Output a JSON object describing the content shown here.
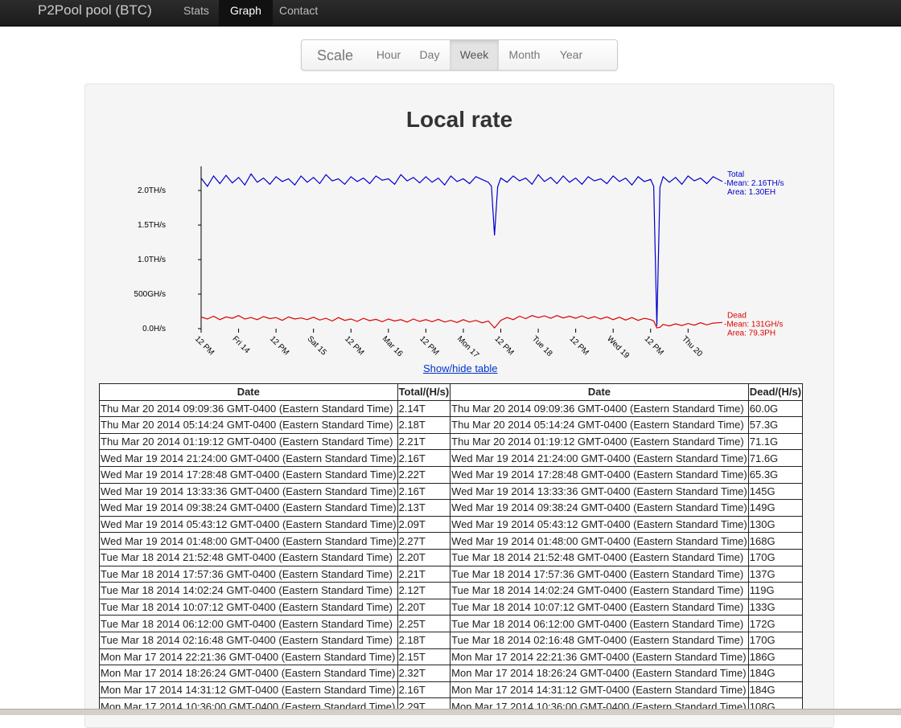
{
  "navbar": {
    "brand": "P2Pool pool (BTC)",
    "items": [
      {
        "label": "Stats",
        "active": false
      },
      {
        "label": "Graph",
        "active": true
      },
      {
        "label": "Contact",
        "active": false
      }
    ]
  },
  "scale": {
    "label": "Scale",
    "options": [
      {
        "label": "Hour",
        "active": false
      },
      {
        "label": "Day",
        "active": false
      },
      {
        "label": "Week",
        "active": true
      },
      {
        "label": "Month",
        "active": false
      },
      {
        "label": "Year",
        "active": false
      }
    ]
  },
  "graph": {
    "title": "Local rate",
    "toggle_label": "Show/hide table"
  },
  "chart_data": {
    "type": "line",
    "title": "Local rate",
    "y_ticks": [
      "0.0H/s",
      "500GH/s",
      "1.0TH/s",
      "1.5TH/s",
      "2.0TH/s"
    ],
    "y_tick_values": [
      0,
      500,
      1000,
      1500,
      2000
    ],
    "ylim": [
      0,
      2350
    ],
    "x_ticks": [
      "12 PM",
      "Fri 14",
      "12 PM",
      "Sat 15",
      "12 PM",
      "Mar 16",
      "12 PM",
      "Mon 17",
      "12 PM",
      "Tue 18",
      "12 PM",
      "Wed 19",
      "12 PM",
      "Thu 20"
    ],
    "x_tick_hours": [
      0,
      12,
      24,
      36,
      48,
      60,
      72,
      84,
      96,
      108,
      120,
      132,
      144,
      156
    ],
    "x_range_hours": [
      0,
      167
    ],
    "series": [
      {
        "name": "Total",
        "color": "#0000cc",
        "labels": [
          "Total",
          "-Mean: 2.16TH/s",
          "Area: 1.30EH"
        ],
        "points": [
          [
            0,
            2180
          ],
          [
            2,
            2060
          ],
          [
            4,
            2210
          ],
          [
            6,
            2100
          ],
          [
            8,
            2220
          ],
          [
            10,
            2110
          ],
          [
            12,
            2190
          ],
          [
            14,
            2080
          ],
          [
            16,
            2240
          ],
          [
            18,
            2120
          ],
          [
            20,
            2180
          ],
          [
            22,
            2090
          ],
          [
            24,
            2200
          ],
          [
            26,
            2130
          ],
          [
            28,
            2170
          ],
          [
            30,
            2080
          ],
          [
            32,
            2210
          ],
          [
            34,
            2120
          ],
          [
            36,
            2190
          ],
          [
            38,
            2100
          ],
          [
            40,
            2230
          ],
          [
            42,
            2140
          ],
          [
            44,
            2170
          ],
          [
            46,
            2090
          ],
          [
            48,
            2200
          ],
          [
            50,
            2130
          ],
          [
            52,
            2180
          ],
          [
            54,
            2100
          ],
          [
            56,
            2210
          ],
          [
            58,
            2150
          ],
          [
            60,
            2170
          ],
          [
            62,
            2090
          ],
          [
            64,
            2230
          ],
          [
            66,
            2140
          ],
          [
            68,
            2190
          ],
          [
            70,
            2110
          ],
          [
            72,
            2200
          ],
          [
            74,
            2120
          ],
          [
            76,
            2180
          ],
          [
            78,
            2080
          ],
          [
            80,
            2210
          ],
          [
            82,
            2130
          ],
          [
            84,
            2170
          ],
          [
            86,
            2100
          ],
          [
            88,
            2200
          ],
          [
            90,
            2160
          ],
          [
            92,
            2120
          ],
          [
            93,
            2060
          ],
          [
            94,
            1350
          ],
          [
            95,
            2050
          ],
          [
            96,
            2180
          ],
          [
            98,
            2120
          ],
          [
            100,
            2210
          ],
          [
            102,
            2140
          ],
          [
            104,
            2180
          ],
          [
            106,
            2090
          ],
          [
            108,
            2230
          ],
          [
            110,
            2130
          ],
          [
            112,
            2190
          ],
          [
            114,
            2100
          ],
          [
            116,
            2210
          ],
          [
            118,
            2120
          ],
          [
            120,
            2180
          ],
          [
            122,
            2090
          ],
          [
            124,
            2200
          ],
          [
            126,
            2140
          ],
          [
            128,
            2170
          ],
          [
            130,
            2100
          ],
          [
            132,
            2210
          ],
          [
            134,
            2130
          ],
          [
            136,
            2180
          ],
          [
            138,
            2080
          ],
          [
            140,
            2200
          ],
          [
            142,
            2130
          ],
          [
            144,
            2160
          ],
          [
            145,
            2060
          ],
          [
            146,
            40
          ],
          [
            147,
            2050
          ],
          [
            148,
            2200
          ],
          [
            150,
            2120
          ],
          [
            152,
            2190
          ],
          [
            154,
            2090
          ],
          [
            156,
            2210
          ],
          [
            158,
            2140
          ],
          [
            160,
            2180
          ],
          [
            162,
            2100
          ],
          [
            164,
            2200
          ],
          [
            167,
            2130
          ]
        ]
      },
      {
        "name": "Dead",
        "color": "#dd0000",
        "labels": [
          "Dead",
          "-Mean: 131GH/s",
          "Area: 79.3PH"
        ],
        "points": [
          [
            0,
            170
          ],
          [
            2,
            140
          ],
          [
            4,
            180
          ],
          [
            6,
            130
          ],
          [
            8,
            170
          ],
          [
            10,
            150
          ],
          [
            12,
            190
          ],
          [
            14,
            140
          ],
          [
            16,
            160
          ],
          [
            18,
            130
          ],
          [
            20,
            175
          ],
          [
            22,
            145
          ],
          [
            24,
            160
          ],
          [
            26,
            120
          ],
          [
            28,
            170
          ],
          [
            30,
            140
          ],
          [
            32,
            155
          ],
          [
            34,
            130
          ],
          [
            36,
            165
          ],
          [
            38,
            125
          ],
          [
            40,
            150
          ],
          [
            42,
            110
          ],
          [
            44,
            160
          ],
          [
            46,
            120
          ],
          [
            48,
            140
          ],
          [
            50,
            105
          ],
          [
            52,
            150
          ],
          [
            54,
            115
          ],
          [
            56,
            135
          ],
          [
            58,
            100
          ],
          [
            60,
            140
          ],
          [
            62,
            110
          ],
          [
            64,
            130
          ],
          [
            66,
            95
          ],
          [
            68,
            140
          ],
          [
            70,
            105
          ],
          [
            72,
            130
          ],
          [
            74,
            100
          ],
          [
            76,
            135
          ],
          [
            78,
            95
          ],
          [
            80,
            120
          ],
          [
            82,
            90
          ],
          [
            84,
            130
          ],
          [
            86,
            95
          ],
          [
            88,
            120
          ],
          [
            90,
            85
          ],
          [
            92,
            110
          ],
          [
            94,
            10
          ],
          [
            96,
            120
          ],
          [
            98,
            160
          ],
          [
            100,
            130
          ],
          [
            102,
            180
          ],
          [
            104,
            145
          ],
          [
            106,
            190
          ],
          [
            108,
            160
          ],
          [
            110,
            185
          ],
          [
            112,
            150
          ],
          [
            114,
            190
          ],
          [
            116,
            155
          ],
          [
            118,
            180
          ],
          [
            120,
            150
          ],
          [
            122,
            185
          ],
          [
            124,
            145
          ],
          [
            126,
            175
          ],
          [
            128,
            140
          ],
          [
            130,
            170
          ],
          [
            132,
            130
          ],
          [
            134,
            165
          ],
          [
            136,
            125
          ],
          [
            138,
            160
          ],
          [
            140,
            120
          ],
          [
            142,
            150
          ],
          [
            144,
            130
          ],
          [
            145,
            110
          ],
          [
            146,
            10
          ],
          [
            147,
            20
          ],
          [
            148,
            60
          ],
          [
            150,
            40
          ],
          [
            152,
            70
          ],
          [
            154,
            45
          ],
          [
            156,
            75
          ],
          [
            158,
            50
          ],
          [
            160,
            85
          ],
          [
            162,
            55
          ],
          [
            164,
            80
          ],
          [
            167,
            90
          ]
        ]
      }
    ]
  },
  "table": {
    "headers": [
      "Date",
      "Total/(H/s)",
      "Date",
      "Dead/(H/s)"
    ],
    "rows": [
      [
        "Thu Mar 20 2014 09:09:36 GMT-0400 (Eastern Standard Time)",
        "2.14T",
        "Thu Mar 20 2014 09:09:36 GMT-0400 (Eastern Standard Time)",
        "60.0G"
      ],
      [
        "Thu Mar 20 2014 05:14:24 GMT-0400 (Eastern Standard Time)",
        "2.18T",
        "Thu Mar 20 2014 05:14:24 GMT-0400 (Eastern Standard Time)",
        "57.3G"
      ],
      [
        "Thu Mar 20 2014 01:19:12 GMT-0400 (Eastern Standard Time)",
        "2.21T",
        "Thu Mar 20 2014 01:19:12 GMT-0400 (Eastern Standard Time)",
        "71.1G"
      ],
      [
        "Wed Mar 19 2014 21:24:00 GMT-0400 (Eastern Standard Time)",
        "2.16T",
        "Wed Mar 19 2014 21:24:00 GMT-0400 (Eastern Standard Time)",
        "71.6G"
      ],
      [
        "Wed Mar 19 2014 17:28:48 GMT-0400 (Eastern Standard Time)",
        "2.22T",
        "Wed Mar 19 2014 17:28:48 GMT-0400 (Eastern Standard Time)",
        "65.3G"
      ],
      [
        "Wed Mar 19 2014 13:33:36 GMT-0400 (Eastern Standard Time)",
        "2.16T",
        "Wed Mar 19 2014 13:33:36 GMT-0400 (Eastern Standard Time)",
        "145G"
      ],
      [
        "Wed Mar 19 2014 09:38:24 GMT-0400 (Eastern Standard Time)",
        "2.13T",
        "Wed Mar 19 2014 09:38:24 GMT-0400 (Eastern Standard Time)",
        "149G"
      ],
      [
        "Wed Mar 19 2014 05:43:12 GMT-0400 (Eastern Standard Time)",
        "2.09T",
        "Wed Mar 19 2014 05:43:12 GMT-0400 (Eastern Standard Time)",
        "130G"
      ],
      [
        "Wed Mar 19 2014 01:48:00 GMT-0400 (Eastern Standard Time)",
        "2.27T",
        "Wed Mar 19 2014 01:48:00 GMT-0400 (Eastern Standard Time)",
        "168G"
      ],
      [
        "Tue Mar 18 2014 21:52:48 GMT-0400 (Eastern Standard Time)",
        "2.20T",
        "Tue Mar 18 2014 21:52:48 GMT-0400 (Eastern Standard Time)",
        "170G"
      ],
      [
        "Tue Mar 18 2014 17:57:36 GMT-0400 (Eastern Standard Time)",
        "2.21T",
        "Tue Mar 18 2014 17:57:36 GMT-0400 (Eastern Standard Time)",
        "137G"
      ],
      [
        "Tue Mar 18 2014 14:02:24 GMT-0400 (Eastern Standard Time)",
        "2.12T",
        "Tue Mar 18 2014 14:02:24 GMT-0400 (Eastern Standard Time)",
        "119G"
      ],
      [
        "Tue Mar 18 2014 10:07:12 GMT-0400 (Eastern Standard Time)",
        "2.20T",
        "Tue Mar 18 2014 10:07:12 GMT-0400 (Eastern Standard Time)",
        "133G"
      ],
      [
        "Tue Mar 18 2014 06:12:00 GMT-0400 (Eastern Standard Time)",
        "2.25T",
        "Tue Mar 18 2014 06:12:00 GMT-0400 (Eastern Standard Time)",
        "172G"
      ],
      [
        "Tue Mar 18 2014 02:16:48 GMT-0400 (Eastern Standard Time)",
        "2.18T",
        "Tue Mar 18 2014 02:16:48 GMT-0400 (Eastern Standard Time)",
        "170G"
      ],
      [
        "Mon Mar 17 2014 22:21:36 GMT-0400 (Eastern Standard Time)",
        "2.15T",
        "Mon Mar 17 2014 22:21:36 GMT-0400 (Eastern Standard Time)",
        "186G"
      ],
      [
        "Mon Mar 17 2014 18:26:24 GMT-0400 (Eastern Standard Time)",
        "2.32T",
        "Mon Mar 17 2014 18:26:24 GMT-0400 (Eastern Standard Time)",
        "184G"
      ],
      [
        "Mon Mar 17 2014 14:31:12 GMT-0400 (Eastern Standard Time)",
        "2.16T",
        "Mon Mar 17 2014 14:31:12 GMT-0400 (Eastern Standard Time)",
        "184G"
      ],
      [
        "Mon Mar 17 2014 10:36:00 GMT-0400 (Eastern Standard Time)",
        "2.29T",
        "Mon Mar 17 2014 10:36:00 GMT-0400 (Eastern Standard Time)",
        "108G"
      ]
    ]
  }
}
